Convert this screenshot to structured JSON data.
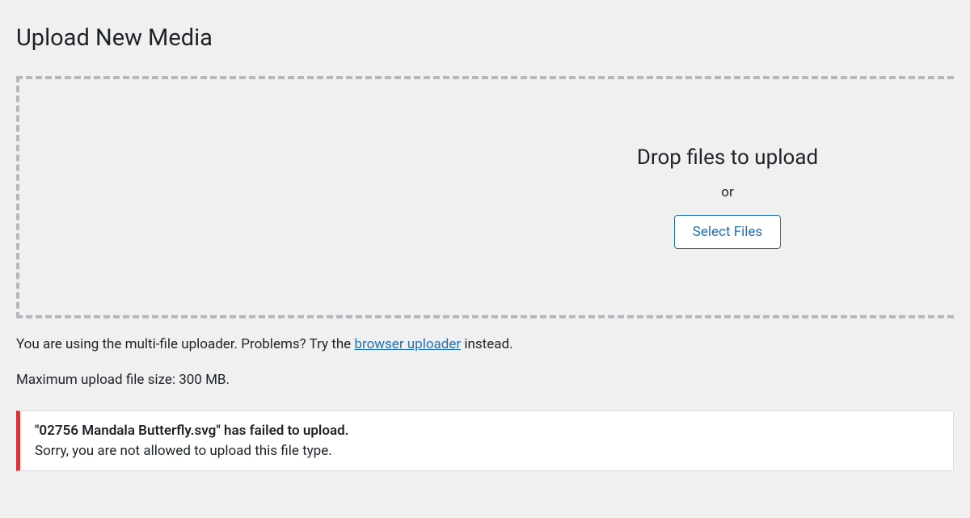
{
  "page": {
    "title": "Upload New Media"
  },
  "dropzone": {
    "instruction": "Drop files to upload",
    "or_text": "or",
    "select_button": "Select Files"
  },
  "uploader_info": {
    "prefix": "You are using the multi-file uploader. Problems? Try the ",
    "link_text": "browser uploader",
    "suffix": " instead."
  },
  "max_size": {
    "text": "Maximum upload file size: 300 MB."
  },
  "error": {
    "title": "\"02756 Mandala Butterfly.svg\" has failed to upload.",
    "message": "Sorry, you are not allowed to upload this file type."
  }
}
